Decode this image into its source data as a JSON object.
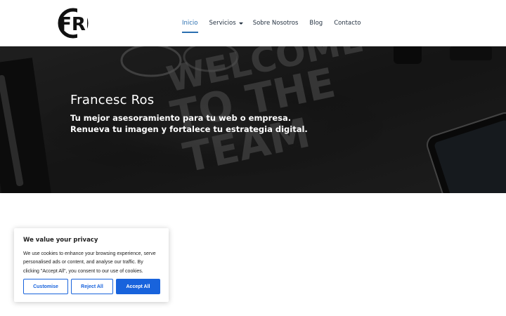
{
  "logo": {
    "name": "FR monogram logo",
    "text": "FR"
  },
  "nav": {
    "items": [
      {
        "label": "Inicio",
        "active": true
      },
      {
        "label": "Servicios",
        "has_dropdown": true
      },
      {
        "label": "Sobre Nosotros"
      },
      {
        "label": "Blog"
      },
      {
        "label": "Contacto"
      }
    ]
  },
  "hero": {
    "title": "Francesc Ros",
    "subtitle_line1": "Tu mejor asesoramiento para tu web o empresa.",
    "subtitle_line2": "Renueva tu imagen y fortalece tu estrategia digital.",
    "background_text": [
      "WELCOME",
      "TO THE",
      "TEAM"
    ]
  },
  "cookie": {
    "title": "We value your privacy",
    "line1": "We use cookies to enhance your browsing experience, serve",
    "line2": "personalised ads or content, and analyse our traffic. By",
    "line3": "clicking \"Accept All\", you consent to our use of cookies.",
    "customise": "Customise",
    "reject": "Reject All",
    "accept": "Accept All"
  },
  "colors": {
    "accent": "#2a6fb0",
    "cookie_button": "#1863dc",
    "nav_text": "#1f2d3d"
  }
}
